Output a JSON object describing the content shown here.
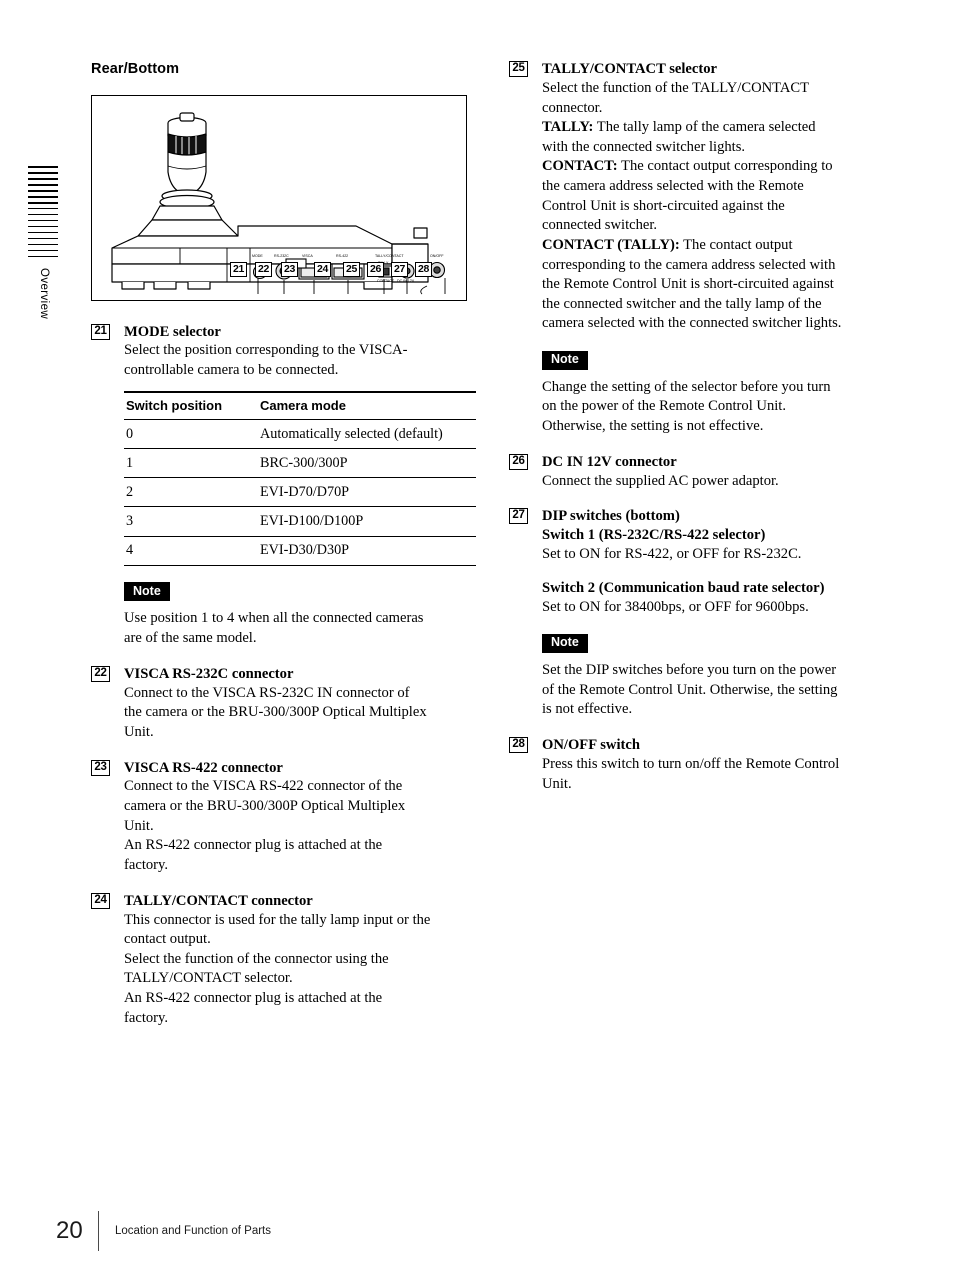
{
  "margin": {
    "tab_label": "Overview",
    "stripe_count": 16
  },
  "left_column": {
    "section_title": "Rear/Bottom",
    "figure": {
      "name": "rear-bottom-diagram",
      "callouts": [
        "21",
        "22",
        "23",
        "24",
        "25",
        "26",
        "27",
        "28"
      ],
      "panel_labels": [
        "MODE",
        "RS-232C",
        "VISCA",
        "RS-422",
        "TALLY/CONTACT",
        "TALLY",
        "CONTACT",
        "DC IN 12V",
        "ON/OFF"
      ]
    },
    "items": [
      {
        "num": "21",
        "title": "MODE selector",
        "lines": [
          "Select the position corresponding to the VISCA-",
          "controllable camera to be connected."
        ]
      }
    ],
    "table": {
      "headers": [
        "Switch position",
        "Camera mode"
      ],
      "rows": [
        [
          "0",
          "Automatically selected (default)"
        ],
        [
          "1",
          "BRC-300/300P"
        ],
        [
          "2",
          "EVI-D70/D70P"
        ],
        [
          "3",
          "EVI-D100/D100P"
        ],
        [
          "4",
          "EVI-D30/D30P"
        ]
      ]
    },
    "note_1": {
      "badge": "Note",
      "lines": [
        "Use position 1 to 4 when all the connected cameras",
        "are of the same model."
      ]
    },
    "item_22": {
      "num": "22",
      "title": "VISCA RS-232C connector",
      "lines": [
        "Connect to the VISCA RS-232C IN connector of",
        "the camera or the BRU-300/300P Optical Multiplex",
        "Unit."
      ]
    },
    "item_23": {
      "num": "23",
      "title": "VISCA RS-422 connector",
      "lines": [
        "Connect to the VISCA RS-422 connector of the",
        "camera or the BRU-300/300P Optical Multiplex",
        "Unit.",
        "An RS-422 connector plug is attached at the",
        "factory."
      ]
    },
    "item_24": {
      "num": "24",
      "title": "TALLY/CONTACT connector",
      "lines": [
        "This connector is used for the tally lamp input or the",
        "contact output.",
        "Select the function of the connector using the",
        "TALLY/CONTACT selector.",
        "An RS-422 connector plug is attached at the",
        "factory."
      ]
    }
  },
  "right_column": {
    "item_25": {
      "num": "25",
      "title": "TALLY/CONTACT selector",
      "lines": [
        "Select the function of the TALLY/CONTACT",
        "connector."
      ],
      "tally_term": "TALLY:",
      "tally_lines": [
        " The tally lamp of the camera selected",
        "with the connected switcher lights."
      ],
      "contact_term": "CONTACT:",
      "contact_lines": [
        " The contact output corresponding to",
        "the camera address selected with the Remote",
        "Control Unit is short-circuited against the",
        "connected switcher."
      ],
      "contact_tally_term": "CONTACT (TALLY):",
      "contact_tally_lines": [
        " The contact output",
        "corresponding to the camera address selected with",
        "the Remote Control Unit is short-circuited against",
        "the connected switcher and the tally lamp of the",
        "camera selected with the connected switcher lights."
      ]
    },
    "note_2": {
      "badge": "Note",
      "lines": [
        "Change the setting of the selector before you turn",
        "on the power of the Remote Control Unit.",
        "Otherwise, the setting is not effective."
      ]
    },
    "item_26": {
      "num": "26",
      "title": "DC IN 12V connector",
      "lines": [
        "Connect the supplied AC power adaptor."
      ]
    },
    "item_27": {
      "num": "27",
      "title": "DIP switches (bottom)",
      "sub_title_1": "Switch 1 (RS-232C/RS-422 selector)",
      "lines_1": [
        "Set to ON for RS-422, or OFF for RS-232C."
      ],
      "sub_title_2": "Switch 2 (Communication baud rate selector)",
      "lines_2": [
        "Set to ON for 38400bps, or OFF for 9600bps."
      ]
    },
    "note_3": {
      "badge": "Note",
      "lines": [
        "Set the DIP switches before you turn on the power",
        "of the Remote Control Unit.  Otherwise, the setting",
        "is not effective."
      ]
    },
    "item_28": {
      "num": "28",
      "title": "ON/OFF switch",
      "lines": [
        "Press this switch to turn on/off the Remote Control",
        "Unit."
      ]
    }
  },
  "footer": {
    "page_number": "20",
    "chapter": "Location and Function of Parts"
  }
}
